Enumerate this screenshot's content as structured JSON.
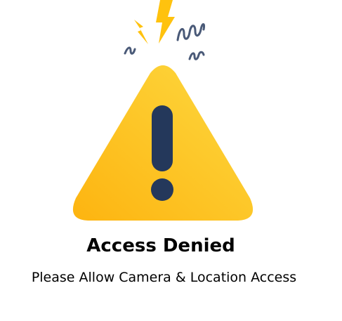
{
  "message": {
    "title": "Access Denied",
    "subtitle": "Please Allow Camera & Location Access"
  },
  "icons": {
    "main": "warning-triangle-icon",
    "accent": "lightning-bolt-icon",
    "squiggle": "squiggle-icon"
  },
  "colors": {
    "triangle_light": "#FDD13A",
    "triangle_dark": "#FDB714",
    "bolt": "#FFC20E",
    "navy": "#24385B",
    "squiggle": "#4A5A78",
    "text": "#000000",
    "background": "#FFFFFF"
  }
}
